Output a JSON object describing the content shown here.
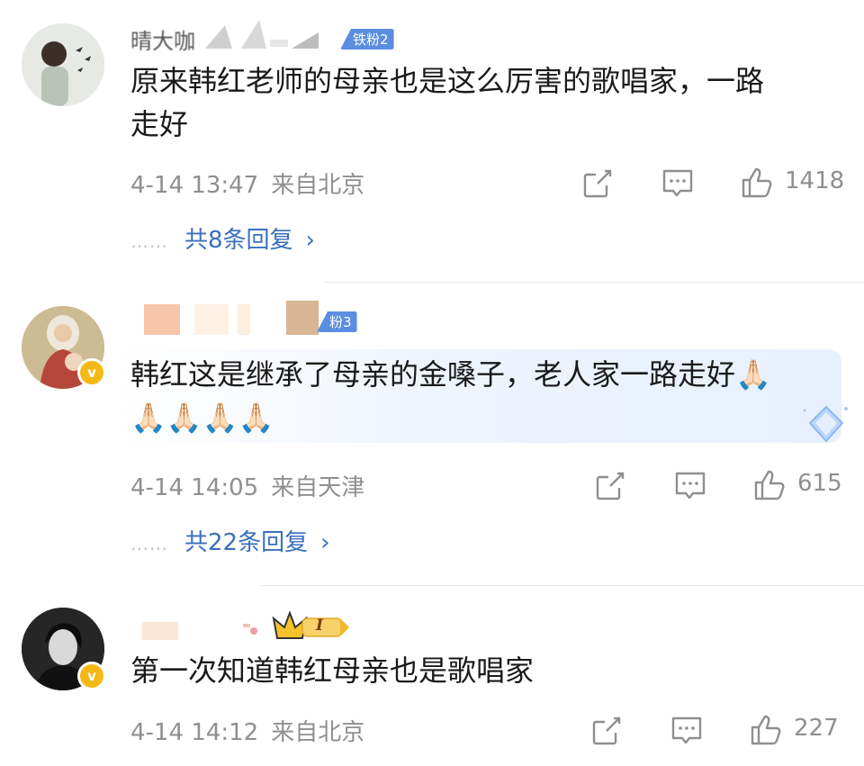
{
  "comments": [
    {
      "username": "晴大咖",
      "fan_badge": "铁粉2",
      "text_line1": "原来韩红老师的母亲也是这么厉害的歌唱家，一路",
      "text_line2": "走好",
      "time": "4-14 13:47",
      "source": "来自北京",
      "likes": "1418",
      "replies_label": "共8条回复",
      "replies_dots": "……",
      "chevron": "›"
    },
    {
      "username": "",
      "fan_badge": "粉3",
      "verified_mark": "v",
      "text_line1": "韩红这是继承了母亲的金嗓子，老人家一路走好🙏🏻",
      "text_line2": "🙏🏻🙏🏻🙏🏻🙏🏻",
      "time": "4-14 14:05",
      "source": "来自天津",
      "likes": "615",
      "replies_label": "共22条回复",
      "replies_dots": "……",
      "chevron": "›"
    },
    {
      "username": "",
      "level_badge": "I",
      "verified_mark": "v",
      "text_line1": "第一次知道韩红母亲也是歌唱家",
      "time": "4-14 14:12",
      "source": "来自北京",
      "likes": "227"
    }
  ],
  "icons": {
    "share": "share-icon",
    "comment": "comment-icon",
    "like": "thumbs-up-icon"
  },
  "colors": {
    "link_blue": "#3a6fbf",
    "meta_gray": "#8f8f8f",
    "fan_badge_blue": "#5b8de0",
    "verified_gold": "#f5b915"
  }
}
